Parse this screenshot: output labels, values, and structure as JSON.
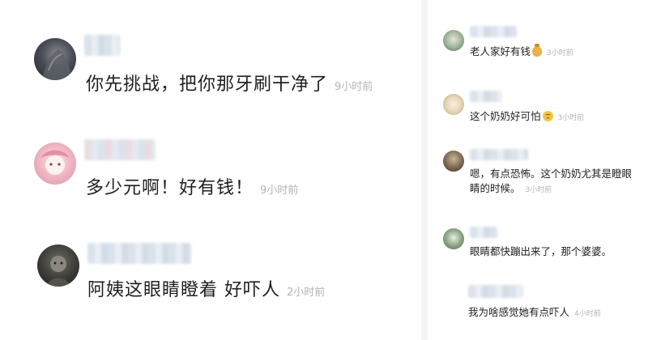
{
  "left_comments": [
    {
      "text": "你先挑战，把你那牙刷干净了",
      "time": "9小时前"
    },
    {
      "text": "多少元啊！好有钱！",
      "time": "9小时前"
    },
    {
      "text": "阿姨这眼睛瞪着 好吓人",
      "time": "2小时前"
    }
  ],
  "right_comments": [
    {
      "text": "老人家好有钱",
      "emoji": "money-bag-icon",
      "time": "3小时前"
    },
    {
      "text": "这个奶奶好可怕",
      "emoji": "sad-face-icon",
      "time": "3小时前"
    },
    {
      "line1": "嗯，有点恐怖。这个奶奶尤其是瞪眼",
      "line2": "睛的时候。",
      "time": "3小时前"
    },
    {
      "text": "眼睛都快蹦出来了，那个婆婆。"
    },
    {
      "text": "我为啥感觉她有点吓人",
      "time": "4小时前"
    }
  ],
  "colors": {
    "text": "#1f1f1f",
    "timestamp": "#b3b3b3",
    "background": "#ffffff"
  }
}
